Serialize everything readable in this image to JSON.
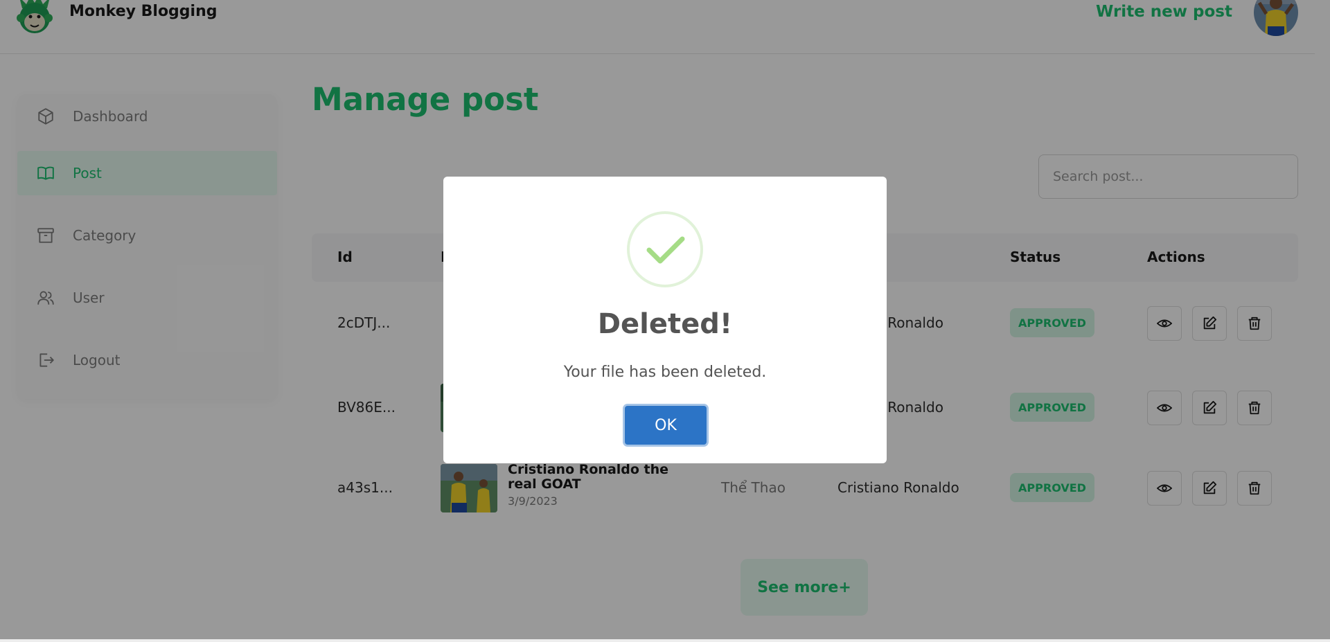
{
  "header": {
    "brand": "Monkey Blogging",
    "write_label": "Write new post"
  },
  "sidebar": {
    "items": [
      {
        "label": "Dashboard",
        "icon": "cube-icon",
        "active": false
      },
      {
        "label": "Post",
        "icon": "book-icon",
        "active": true
      },
      {
        "label": "Category",
        "icon": "archive-icon",
        "active": false
      },
      {
        "label": "User",
        "icon": "users-icon",
        "active": false
      },
      {
        "label": "Logout",
        "icon": "logout-icon",
        "active": false
      }
    ]
  },
  "main": {
    "title": "Manage post",
    "search_placeholder": "Search post...",
    "table": {
      "headers": [
        "Id",
        "P",
        "Status",
        "Actions"
      ],
      "rows": [
        {
          "id": "2cDTJ...",
          "title": "",
          "date": "",
          "category": "",
          "author": "no Ronaldo",
          "status": "APPROVED"
        },
        {
          "id": "BV86E...",
          "title": "",
          "date": "",
          "category": "",
          "author": "no Ronaldo",
          "status": "APPROVED"
        },
        {
          "id": "a43s1...",
          "title": "Cristiano Ronaldo the real GOAT",
          "date": "3/9/2023",
          "category": "Thể Thao",
          "author": "Cristiano Ronaldo",
          "status": "APPROVED"
        }
      ]
    },
    "see_more_label": "See more+"
  },
  "modal": {
    "title": "Deleted!",
    "text": "Your file has been deleted.",
    "ok_label": "OK",
    "icon": "success-check-icon"
  },
  "colors": {
    "accent": "#1dc071",
    "ok_button": "#2c74c6",
    "overlay": "rgba(0,0,0,0.4)"
  }
}
